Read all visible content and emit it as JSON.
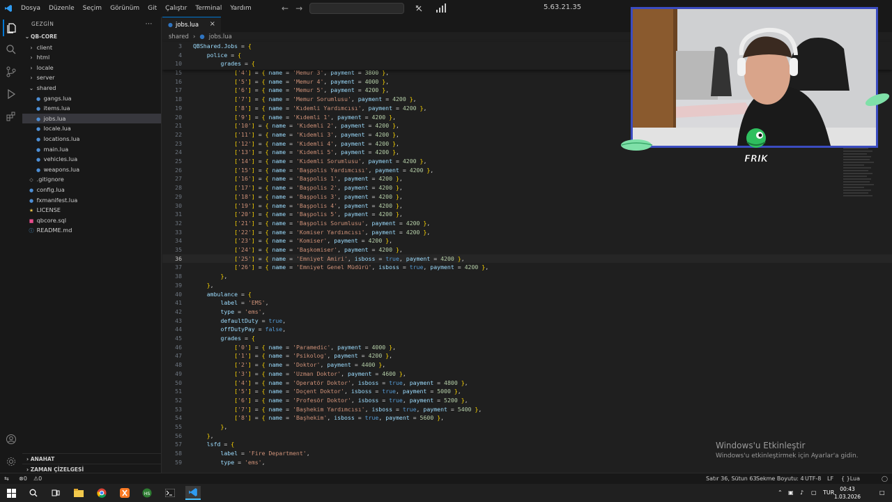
{
  "titlebar": {
    "menu": [
      "Dosya",
      "Düzenle",
      "Seçim",
      "Görünüm",
      "Git",
      "Çalıştır",
      "Terminal",
      "Yardım"
    ],
    "address": "5.63.21.35"
  },
  "sidebar": {
    "header": "GEZGİN",
    "root": "QB-CORE",
    "items": [
      {
        "label": "client",
        "kind": "folder",
        "depth": 1
      },
      {
        "label": "html",
        "kind": "folder",
        "depth": 1
      },
      {
        "label": "locale",
        "kind": "folder",
        "depth": 1
      },
      {
        "label": "server",
        "kind": "folder",
        "depth": 1
      },
      {
        "label": "shared",
        "kind": "folder-open",
        "depth": 1
      },
      {
        "label": "gangs.lua",
        "kind": "lua",
        "depth": 2
      },
      {
        "label": "items.lua",
        "kind": "lua",
        "depth": 2
      },
      {
        "label": "jobs.lua",
        "kind": "lua",
        "depth": 2,
        "selected": true
      },
      {
        "label": "locale.lua",
        "kind": "lua",
        "depth": 2
      },
      {
        "label": "locations.lua",
        "kind": "lua",
        "depth": 2
      },
      {
        "label": "main.lua",
        "kind": "lua",
        "depth": 2
      },
      {
        "label": "vehicles.lua",
        "kind": "lua",
        "depth": 2
      },
      {
        "label": "weapons.lua",
        "kind": "lua",
        "depth": 2
      },
      {
        "label": ".gitignore",
        "kind": "git",
        "depth": 1
      },
      {
        "label": "config.lua",
        "kind": "lua",
        "depth": 1
      },
      {
        "label": "fxmanifest.lua",
        "kind": "lua",
        "depth": 1
      },
      {
        "label": "LICENSE",
        "kind": "license",
        "depth": 1
      },
      {
        "label": "qbcore.sql",
        "kind": "sql",
        "depth": 1
      },
      {
        "label": "README.md",
        "kind": "md",
        "depth": 1
      }
    ],
    "outline": "ANAHAT",
    "timeline": "ZAMAN ÇİZELGESİ"
  },
  "editor": {
    "tab": "jobs.lua",
    "breadcrumb": [
      "shared",
      "jobs.lua"
    ],
    "sticky": [
      {
        "n": "3",
        "text": "QBShared.Jobs = {"
      },
      {
        "n": "4",
        "text": "    police = {"
      },
      {
        "n": "10",
        "text": "        grades = {"
      }
    ],
    "current_line": "36",
    "lines": [
      {
        "n": "15",
        "text": "            ['4'] = { name = 'Memur 3', payment = 3800 },"
      },
      {
        "n": "16",
        "text": "            ['5'] = { name = 'Memur 4', payment = 4000 },"
      },
      {
        "n": "17",
        "text": "            ['6'] = { name = 'Memur 5', payment = 4200 },"
      },
      {
        "n": "18",
        "text": "            ['7'] = { name = 'Memur Sorumlusu', payment = 4200 },"
      },
      {
        "n": "19",
        "text": "            ['8'] = { name = 'Kıdemli Yardımcısı', payment = 4200 },"
      },
      {
        "n": "20",
        "text": "            ['9'] = { name = 'Kıdemli 1', payment = 4200 },"
      },
      {
        "n": "21",
        "text": "            ['10'] = { name = 'Kıdemli 2', payment = 4200 },"
      },
      {
        "n": "22",
        "text": "            ['11'] = { name = 'Kıdemli 3', payment = 4200 },"
      },
      {
        "n": "23",
        "text": "            ['12'] = { name = 'Kıdemli 4', payment = 4200 },"
      },
      {
        "n": "24",
        "text": "            ['13'] = { name = 'Kıdemli 5', payment = 4200 },"
      },
      {
        "n": "25",
        "text": "            ['14'] = { name = 'Kıdemli Sorumlusu', payment = 4200 },"
      },
      {
        "n": "26",
        "text": "            ['15'] = { name = 'Başpolis Yardımcısı', payment = 4200 },"
      },
      {
        "n": "27",
        "text": "            ['16'] = { name = 'Başpolis 1', payment = 4200 },"
      },
      {
        "n": "28",
        "text": "            ['17'] = { name = 'Başpolis 2', payment = 4200 },"
      },
      {
        "n": "29",
        "text": "            ['18'] = { name = 'Başpolis 3', payment = 4200 },"
      },
      {
        "n": "30",
        "text": "            ['19'] = { name = 'Başpolis 4', payment = 4200 },"
      },
      {
        "n": "31",
        "text": "            ['20'] = { name = 'Başpolis 5', payment = 4200 },"
      },
      {
        "n": "32",
        "text": "            ['21'] = { name = 'Başpolis Sorumlusu', payment = 4200 },"
      },
      {
        "n": "33",
        "text": "            ['22'] = { name = 'Komiser Yardımcısı', payment = 4200 },"
      },
      {
        "n": "34",
        "text": "            ['23'] = { name = 'Komiser', payment = 4200 },"
      },
      {
        "n": "35",
        "text": "            ['24'] = { name = 'Başkomiser', payment = 4200 },"
      },
      {
        "n": "36",
        "text": "            ['25'] = { name = 'Emniyet Amiri', isboss = true, payment = 4200 },"
      },
      {
        "n": "37",
        "text": "            ['26'] = { name = 'Emniyet Genel Müdürü', isboss = true, payment = 4200 },"
      },
      {
        "n": "38",
        "text": "        },"
      },
      {
        "n": "39",
        "text": "    },"
      },
      {
        "n": "40",
        "text": "    ambulance = {"
      },
      {
        "n": "41",
        "text": "        label = 'EMS',"
      },
      {
        "n": "42",
        "text": "        type = 'ems',"
      },
      {
        "n": "43",
        "text": "        defaultDuty = true,"
      },
      {
        "n": "44",
        "text": "        offDutyPay = false,"
      },
      {
        "n": "45",
        "text": "        grades = {"
      },
      {
        "n": "46",
        "text": "            ['0'] = { name = 'Paramedic', payment = 4000 },"
      },
      {
        "n": "47",
        "text": "            ['1'] = { name = 'Psikolog', payment = 4200 },"
      },
      {
        "n": "48",
        "text": "            ['2'] = { name = 'Doktor', payment = 4400 },"
      },
      {
        "n": "49",
        "text": "            ['3'] = { name = 'Uzman Doktor', payment = 4600 },"
      },
      {
        "n": "50",
        "text": "            ['4'] = { name = 'Operatör Doktor', isboss = true, payment = 4800 },"
      },
      {
        "n": "51",
        "text": "            ['5'] = { name = 'Doçent Doktor', isboss = true, payment = 5000 },"
      },
      {
        "n": "52",
        "text": "            ['6'] = { name = 'Profesör Doktor', isboss = true, payment = 5200 },"
      },
      {
        "n": "53",
        "text": "            ['7'] = { name = 'Başhekim Yardımcısı', isboss = true, payment = 5400 },"
      },
      {
        "n": "54",
        "text": "            ['8'] = { name = 'Başhekim', isboss = true, payment = 5600 },"
      },
      {
        "n": "55",
        "text": "        },"
      },
      {
        "n": "56",
        "text": "    },"
      },
      {
        "n": "57",
        "text": "    lsfd = {"
      },
      {
        "n": "58",
        "text": "        label = 'Fire Department',"
      },
      {
        "n": "59",
        "text": "        type = 'ems',"
      }
    ]
  },
  "watermark": {
    "title": "Windows'u Etkinleştir",
    "subtitle": "Windows'u etkinleştirmek için Ayarlar'a gidin."
  },
  "overlay": {
    "logo_text": "FRIK"
  },
  "statusbar": {
    "errors": "0",
    "warnings": "0",
    "position": "Satır 36, Sütun 63",
    "indent": "Sekme Boyutu: 4",
    "encoding": "UTF-8",
    "eol": "LF",
    "language": "Lua"
  },
  "taskbar": {
    "lang": "TUR",
    "time": "00:43",
    "date": "1.03.2026"
  },
  "colors": {
    "accent": "#0078d4",
    "webcam_border": "#3b4cc0",
    "string": "#ce9178",
    "number": "#b5cea8",
    "keyword": "#569cd6"
  }
}
